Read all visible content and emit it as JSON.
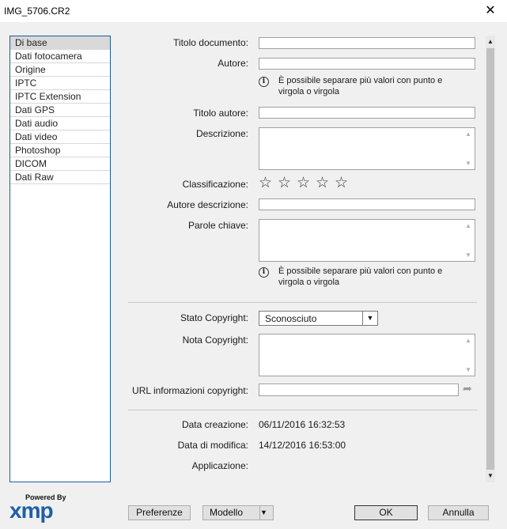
{
  "window": {
    "title": "IMG_5706.CR2"
  },
  "nav": {
    "items": [
      "Di base",
      "Dati fotocamera",
      "Origine",
      "IPTC",
      "IPTC Extension",
      "Dati GPS",
      "Dati audio",
      "Dati video",
      "Photoshop",
      "DICOM",
      "Dati Raw"
    ],
    "selected_index": 0
  },
  "form": {
    "titolo_documento": {
      "label": "Titolo documento:",
      "value": ""
    },
    "autore": {
      "label": "Autore:",
      "value": ""
    },
    "info_autore": "È possibile separare più valori con punto e virgola o virgola",
    "titolo_autore": {
      "label": "Titolo autore:",
      "value": ""
    },
    "descrizione": {
      "label": "Descrizione:",
      "value": ""
    },
    "classificazione": {
      "label": "Classificazione:",
      "rating": 0,
      "max": 5
    },
    "autore_descrizione": {
      "label": "Autore descrizione:",
      "value": ""
    },
    "parole_chiave": {
      "label": "Parole chiave:",
      "value": ""
    },
    "info_parole": "È possibile separare più valori con punto e virgola o virgola",
    "stato_copyright": {
      "label": "Stato Copyright:",
      "value": "Sconosciuto"
    },
    "nota_copyright": {
      "label": "Nota Copyright:",
      "value": ""
    },
    "url_copyright": {
      "label": "URL informazioni copyright:",
      "value": ""
    },
    "data_creazione": {
      "label": "Data creazione:",
      "value": "06/11/2016 16:32:53"
    },
    "data_modifica": {
      "label": "Data di modifica:",
      "value": "14/12/2016 16:53:00"
    },
    "applicazione": {
      "label": "Applicazione:",
      "value": ""
    }
  },
  "logo": {
    "powered_by": "Powered By",
    "name": "xmp"
  },
  "buttons": {
    "preferenze": "Preferenze",
    "modello": "Modello",
    "ok": "OK",
    "annulla": "Annulla"
  }
}
